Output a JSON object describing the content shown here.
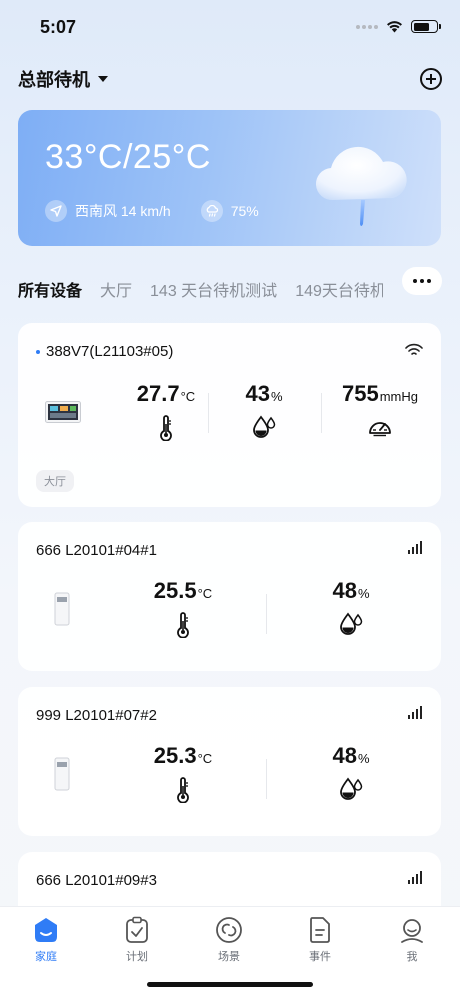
{
  "status": {
    "time": "5:07"
  },
  "header": {
    "home_name": "总部待机"
  },
  "weather": {
    "temp_range": "33°C/25°C",
    "wind": "西南风 14 km/h",
    "humidity": "75%"
  },
  "tabs": [
    "所有设备",
    "大厅",
    "143 天台待机测试",
    "149天台待机"
  ],
  "devices": [
    {
      "title": "388V7(L21103#05)",
      "connection": "wifi",
      "temperature": "27.7",
      "temp_unit": "°C",
      "humidity": "43",
      "hum_unit": "%",
      "pressure": "755",
      "pressure_unit": "mmHg",
      "room": "大厅"
    },
    {
      "title": "666 L20101#04#1",
      "connection": "cellular",
      "temperature": "25.5",
      "temp_unit": "°C",
      "humidity": "48",
      "hum_unit": "%"
    },
    {
      "title": "999 L20101#07#2",
      "connection": "cellular",
      "temperature": "25.3",
      "temp_unit": "°C",
      "humidity": "48",
      "hum_unit": "%"
    },
    {
      "title": "666 L20101#09#3",
      "connection": "cellular"
    }
  ],
  "tabbar": [
    {
      "label": "家庭",
      "icon": "home-icon",
      "active": true
    },
    {
      "label": "计划",
      "icon": "clipboard-check-icon",
      "active": false
    },
    {
      "label": "场景",
      "icon": "scene-icon",
      "active": false
    },
    {
      "label": "事件",
      "icon": "document-icon",
      "active": false
    },
    {
      "label": "我",
      "icon": "user-icon",
      "active": false
    }
  ],
  "colors": {
    "accent": "#2f7cf6",
    "card_gradient_start": "#7eaef5"
  }
}
